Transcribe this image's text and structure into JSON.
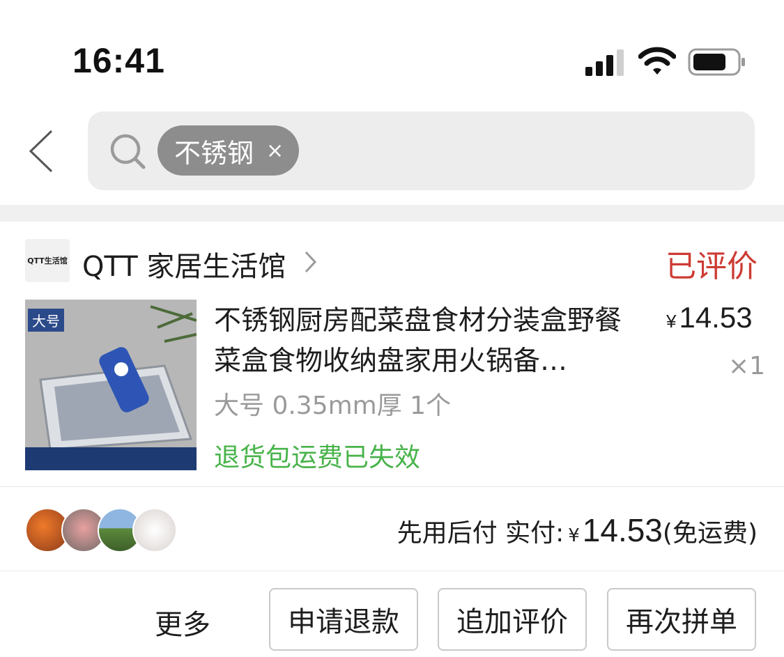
{
  "status_bar": {
    "time": "16:41"
  },
  "header": {
    "search_chip": "不锈钢",
    "chip_close": "×"
  },
  "shop": {
    "logo_text": "QTT生活馆",
    "name": "QTT 家居生活馆",
    "status": "已评价"
  },
  "product": {
    "image_label": "大号",
    "title": "不锈钢厨房配菜盘食材分装盒野餐菜盒食物收纳盘家用火锅备…",
    "currency": "¥",
    "price": "14.53",
    "quantity": "×1",
    "spec": "大号 0.35mm厚 1个",
    "return_note": "退货包运费已失效"
  },
  "payment": {
    "label": "先用后付 实付:",
    "currency": "¥",
    "amount": "14.53",
    "shipping_note": "(免运费)"
  },
  "actions": {
    "more": "更多",
    "refund": "申请退款",
    "add_review": "追加评价",
    "reorder": "再次拼单"
  },
  "colors": {
    "status_red": "#cc3b33",
    "return_green": "#48b34a",
    "search_bg": "#ededed",
    "chip_bg": "#8d8d8d"
  }
}
